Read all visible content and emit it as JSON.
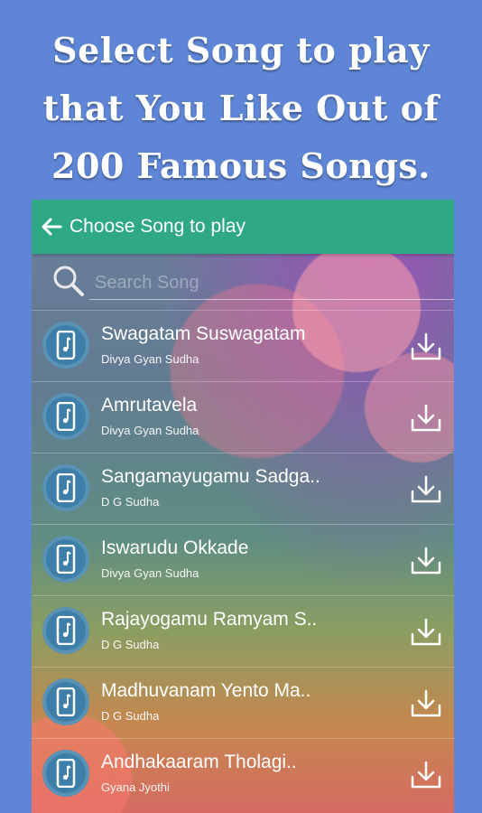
{
  "promo": {
    "line1": "Select Song to play",
    "line2": "that You Like Out of",
    "line3": "200 Famous Songs."
  },
  "appbar": {
    "title": "Choose Song to play",
    "back_icon": "arrow-left-icon"
  },
  "search": {
    "placeholder": "Search Song",
    "icon": "search-icon"
  },
  "songs": [
    {
      "title": "Swagatam Suswagatam",
      "artist": "Divya Gyan Sudha"
    },
    {
      "title": "Amrutavela",
      "artist": "Divya Gyan Sudha"
    },
    {
      "title": "Sangamayugamu Sadga..",
      "artist": "D G Sudha"
    },
    {
      "title": "Iswarudu Okkade",
      "artist": "Divya Gyan Sudha"
    },
    {
      "title": "Rajayogamu Ramyam S..",
      "artist": "D G Sudha"
    },
    {
      "title": "Madhuvanam Yento Ma..",
      "artist": "D G Sudha"
    },
    {
      "title": "Andhakaaram Tholagi..",
      "artist": "Gyana Jyothi"
    }
  ],
  "colors": {
    "background": "#5f86d6",
    "appbar": "#2fa985",
    "avatar": "#3d7fa8"
  }
}
